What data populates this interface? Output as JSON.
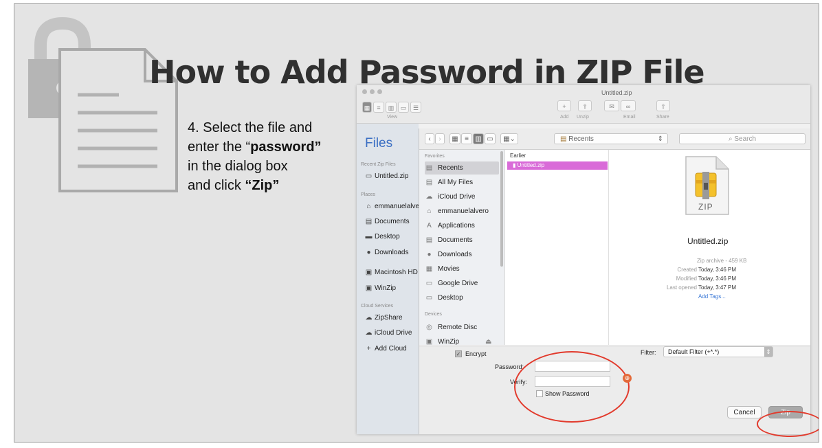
{
  "slide": {
    "title": "How to Add Password in ZIP File",
    "instructions": {
      "line1": "4. Select the file and",
      "line2_pre": "enter the “",
      "line2_bold": "password”",
      "line3": "in the dialog box",
      "line4_pre": "and click ",
      "line4_bold": "“Zip”"
    },
    "accent_color": "#e23a2c"
  },
  "window": {
    "title": "Untitled.zip",
    "toolbar": {
      "view_label": "View",
      "add_label": "Add",
      "unzip_label": "Unzip",
      "email_label": "Email",
      "share_label": "Share"
    }
  },
  "sidebar": {
    "title": "Files",
    "recent_header": "Recent Zip Files",
    "recent_items": [
      {
        "label": "Untitled.zip",
        "icon": "folder-icon"
      }
    ],
    "places_header": "Places",
    "places": [
      {
        "label": "emmanuelalvero",
        "icon": "home-icon"
      },
      {
        "label": "Documents",
        "icon": "document-icon"
      },
      {
        "label": "Desktop",
        "icon": "desktop-icon"
      },
      {
        "label": "Downloads",
        "icon": "download-icon"
      }
    ],
    "drives": [
      {
        "label": "Macintosh HD",
        "icon": "disk-icon"
      },
      {
        "label": "WinZip",
        "icon": "disk-icon"
      }
    ],
    "cloud_header": "Cloud Services",
    "cloud": [
      {
        "label": "ZipShare",
        "icon": "cloud-icon"
      },
      {
        "label": "iCloud Drive",
        "icon": "cloud-icon"
      },
      {
        "label": "Add Cloud",
        "icon": "plus-icon"
      }
    ]
  },
  "dialog": {
    "location": "Recents",
    "search_placeholder": "Search",
    "favorites_header": "Favorites",
    "favorites": [
      {
        "label": "Recents",
        "icon": "clock-icon",
        "selected": true
      },
      {
        "label": "All My Files",
        "icon": "files-icon"
      },
      {
        "label": "iCloud Drive",
        "icon": "cloud-icon"
      },
      {
        "label": "emmanuelalvero",
        "icon": "home-icon"
      },
      {
        "label": "Applications",
        "icon": "applications-icon"
      },
      {
        "label": "Documents",
        "icon": "document-icon"
      },
      {
        "label": "Downloads",
        "icon": "download-icon"
      },
      {
        "label": "Movies",
        "icon": "film-icon"
      },
      {
        "label": "Google Drive",
        "icon": "folder-icon"
      },
      {
        "label": "Desktop",
        "icon": "folder-icon"
      }
    ],
    "devices_header": "Devices",
    "devices": [
      {
        "label": "Remote Disc",
        "icon": "disc-icon"
      },
      {
        "label": "WinZip",
        "icon": "disk-icon"
      }
    ],
    "column_header": "Earlier",
    "selected_file": "Untitled.zip",
    "preview": {
      "badge": "ZIP",
      "filename": "Untitled.zip",
      "kind": "Zip archive - 459 KB",
      "created_label": "Created",
      "created_value": "Today, 3:46 PM",
      "modified_label": "Modified",
      "modified_value": "Today, 3:46 PM",
      "opened_label": "Last opened",
      "opened_value": "Today, 3:47 PM",
      "add_tags": "Add Tags..."
    },
    "encrypt_label": "Encrypt",
    "encrypt_checked": true,
    "password_label": "Password:",
    "password_value": "",
    "verify_label": "Verify:",
    "verify_value": "",
    "show_password_label": "Show Password",
    "filter_label": "Filter:",
    "filter_value": "Default Filter (+*.*)",
    "cancel_label": "Cancel",
    "zip_label": "Zip"
  }
}
